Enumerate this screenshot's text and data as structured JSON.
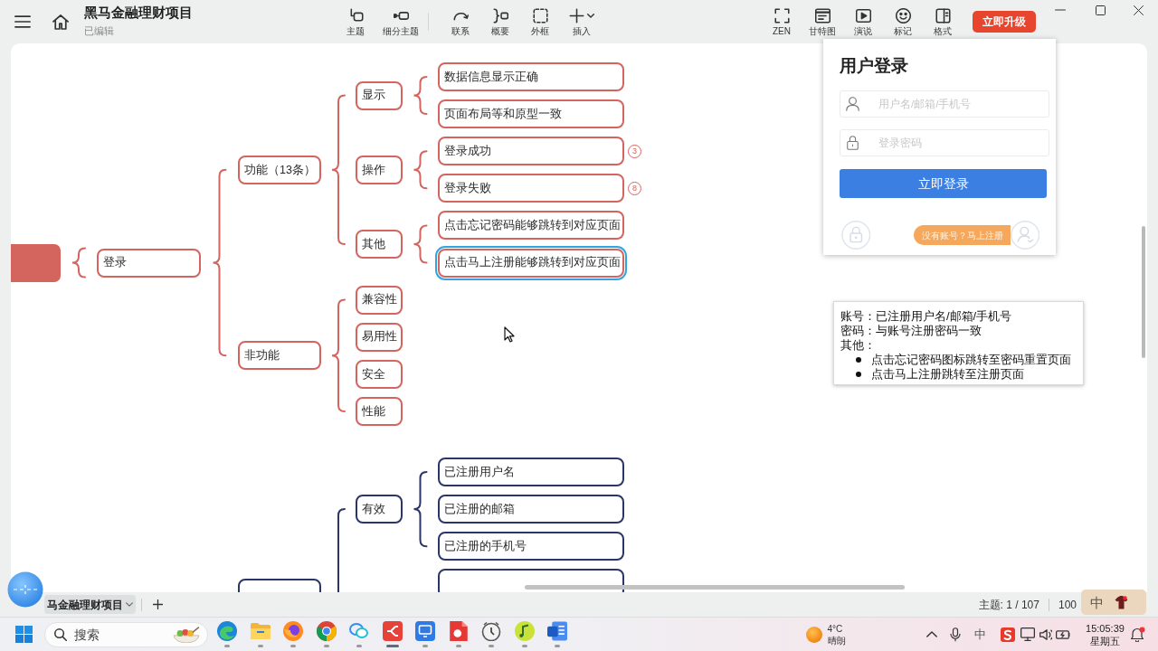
{
  "window": {
    "title": "黑马金融理财项目",
    "status": "已编辑"
  },
  "toolbar": {
    "groups": [
      [
        {
          "kind": "topic",
          "label": "主题"
        },
        {
          "kind": "subtopic",
          "label": "细分主题"
        }
      ],
      [
        {
          "kind": "relationship",
          "label": "联系"
        },
        {
          "kind": "summary",
          "label": "概要"
        },
        {
          "kind": "boundary",
          "label": "外框"
        },
        {
          "kind": "insert",
          "label": "插入"
        }
      ]
    ],
    "view": [
      {
        "kind": "zen",
        "label": "ZEN"
      },
      {
        "kind": "gantt",
        "label": "甘特图"
      },
      {
        "kind": "pitch",
        "label": "演说"
      },
      {
        "kind": "marker",
        "label": "标记"
      },
      {
        "kind": "format",
        "label": "格式"
      }
    ],
    "upgrade_button": "立即升级"
  },
  "mind_map": {
    "branches": [
      {
        "kind": "main",
        "color": "#d4645e",
        "topics": [
          {
            "label": "登录",
            "selected": false,
            "children": [
              {
                "label": "功能（13条）",
                "selected": false,
                "children": [
                  {
                    "label": "显示",
                    "selected": false,
                    "children": [
                      {
                        "label": "数据信息显示正确",
                        "selected": false
                      },
                      {
                        "label": "页面布局等和原型一致",
                        "selected": false
                      }
                    ]
                  },
                  {
                    "label": "操作",
                    "selected": false,
                    "children": [
                      {
                        "label": "登录成功",
                        "selected": false,
                        "count": "3"
                      },
                      {
                        "label": "登录失败",
                        "selected": false,
                        "count": "8"
                      }
                    ]
                  },
                  {
                    "label": "其他",
                    "selected": false,
                    "children": [
                      {
                        "label": "点击忘记密码能够跳转到对应页面",
                        "selected": false
                      },
                      {
                        "label": "点击马上注册能够跳转到对应页面",
                        "selected": true
                      }
                    ]
                  }
                ]
              },
              {
                "label": "非功能",
                "selected": false,
                "children": [
                  {
                    "label": "兼容性",
                    "selected": false
                  },
                  {
                    "label": "易用性",
                    "selected": false
                  },
                  {
                    "label": "安全",
                    "selected": false
                  },
                  {
                    "label": "性能",
                    "selected": false
                  }
                ]
              }
            ]
          }
        ]
      },
      {
        "kind": "continued",
        "color": "#2c3568",
        "topics": [
          {
            "label": "有效",
            "selected": false,
            "children": [
              {
                "label": "已注册用户名",
                "selected": false
              },
              {
                "label": "已注册的邮箱",
                "selected": false
              },
              {
                "label": "已注册的手机号",
                "selected": false
              }
            ]
          }
        ]
      }
    ],
    "note": {
      "lines": [
        "账号：已注册用户名/邮箱/手机号",
        "密码：与账号注册密码一致",
        "其他："
      ],
      "bullets": [
        "点击忘记密码图标跳转至密码重置页面",
        "点击马上注册跳转至注册页面"
      ]
    }
  },
  "login_panel": {
    "title": "用户登录",
    "fields": [
      {
        "kind": "account",
        "placeholder": "用户名/邮箱/手机号"
      },
      {
        "kind": "password",
        "placeholder": "登录密码"
      }
    ],
    "submit_button": "立即登录",
    "register_link": "没有账号？马上注册"
  },
  "sheet_tabs": [
    {
      "label": "马金融理财项目",
      "selected": true
    }
  ],
  "status_bar": {
    "topic_count": "主题: 1 / 107",
    "zoom": "100"
  },
  "ime_toolbar": {
    "mode": "中"
  },
  "taskbar": {
    "search": {
      "placeholder": "搜索"
    },
    "apps": [
      {
        "kind": "wave",
        "active": false
      },
      {
        "kind": "folder",
        "active": false
      },
      {
        "kind": "fox",
        "active": false
      },
      {
        "kind": "rings",
        "active": false
      },
      {
        "kind": "chat",
        "active": false
      },
      {
        "kind": "mindmap",
        "active": true
      },
      {
        "kind": "screen",
        "active": false
      },
      {
        "kind": "pdf",
        "active": false
      },
      {
        "kind": "clock",
        "active": false
      },
      {
        "kind": "music",
        "active": false
      },
      {
        "kind": "doc",
        "active": false
      }
    ],
    "weather": {
      "temperature": "4°C",
      "condition": "晴朗"
    },
    "tray": {
      "ime_mode": "中"
    },
    "clock": {
      "time": "15:05:39",
      "day": "星期五"
    }
  }
}
